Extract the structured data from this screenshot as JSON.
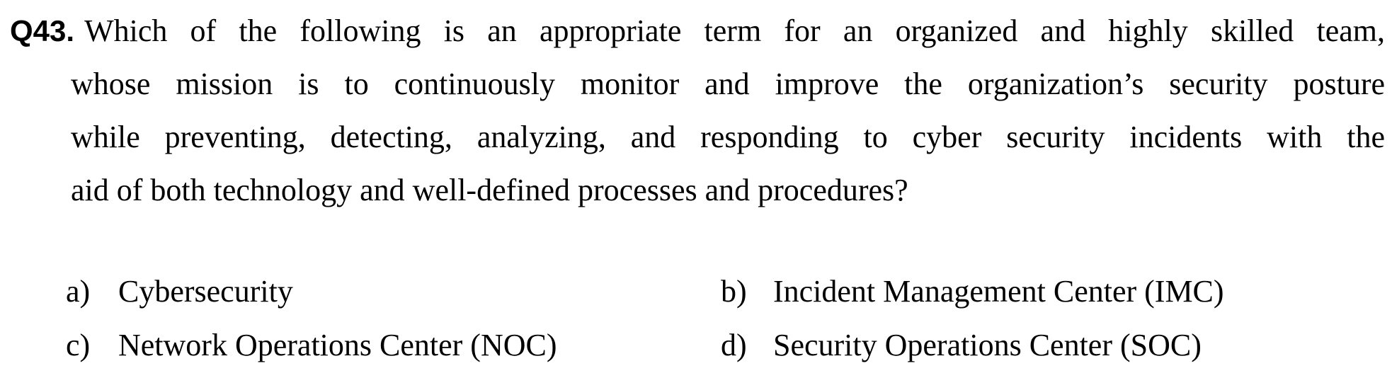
{
  "question": {
    "label": "Q43.",
    "lines": [
      "Which of the following is an appropriate term for an organized and highly skilled team,",
      "whose mission is to continuously monitor and improve the organization’s security posture",
      "while preventing, detecting, analyzing, and responding to cyber security incidents with the",
      "aid of both technology and well-defined processes and procedures?"
    ]
  },
  "options": [
    {
      "letter": "a)",
      "text": "Cybersecurity"
    },
    {
      "letter": "b)",
      "text": "Incident Management Center (IMC)"
    },
    {
      "letter": "c)",
      "text": "Network Operations Center (NOC)"
    },
    {
      "letter": "d)",
      "text": "Security Operations Center (SOC)"
    }
  ]
}
